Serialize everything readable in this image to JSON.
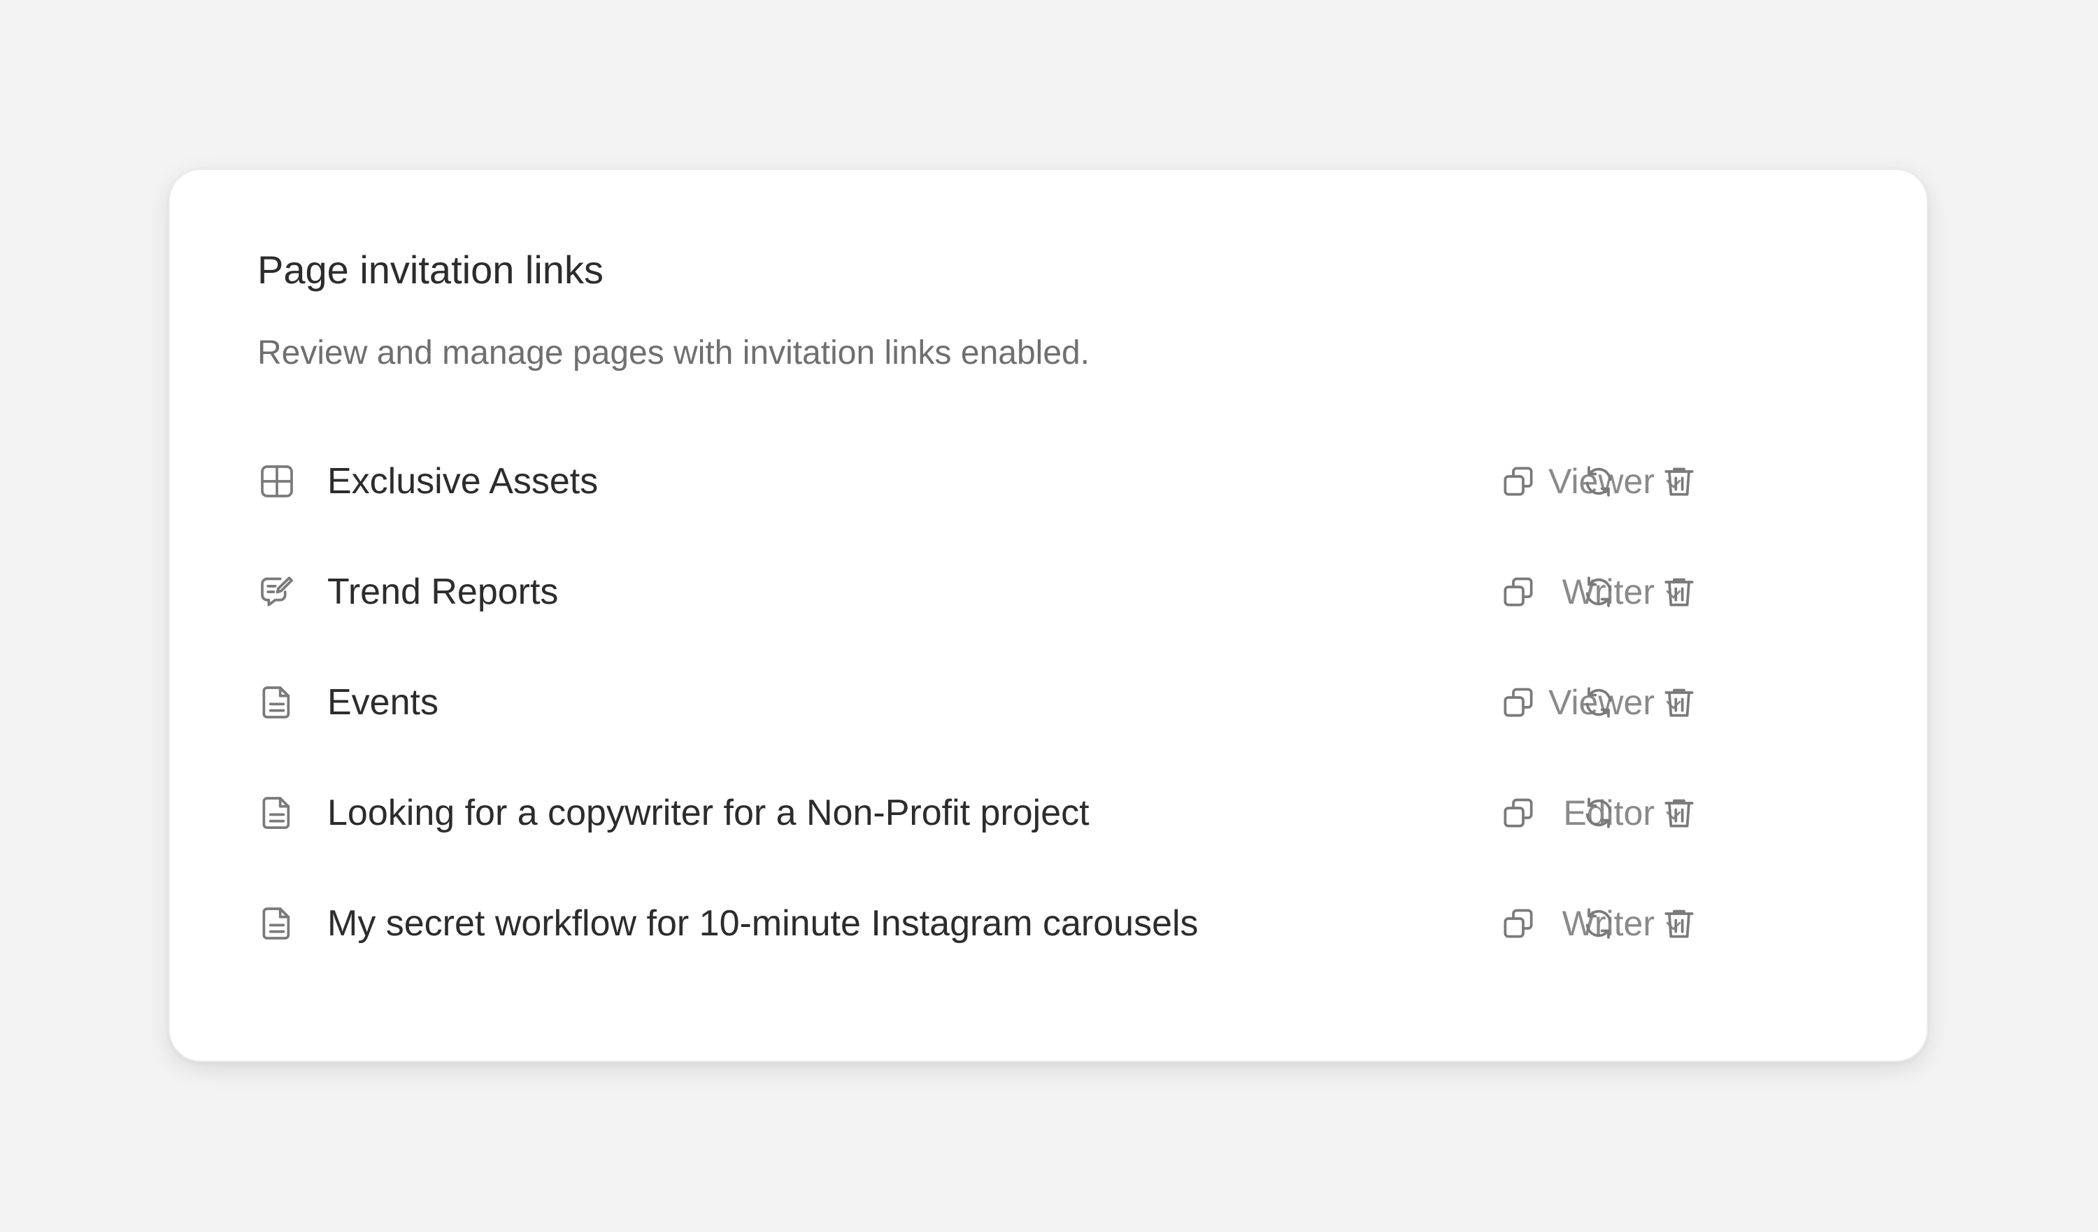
{
  "panel": {
    "title": "Page invitation links",
    "subtitle": "Review and manage pages with invitation links enabled."
  },
  "rows": [
    {
      "icon": "grid-icon",
      "title": "Exclusive Assets",
      "role": "Viewer"
    },
    {
      "icon": "chat-edit-icon",
      "title": "Trend Reports",
      "role": "Writer"
    },
    {
      "icon": "document-icon",
      "title": "Events",
      "role": "Viewer"
    },
    {
      "icon": "document-icon",
      "title": "Looking for a copywriter for a Non-Profit project",
      "role": "Editor"
    },
    {
      "icon": "document-icon",
      "title": "My secret workflow for 10-minute Instagram carousels",
      "role": "Writer"
    }
  ],
  "colors": {
    "background": "#f3f3f3",
    "card": "#ffffff",
    "text": "#2c2c2c",
    "muted": "#6f6f6f",
    "icon": "#7a7a7a"
  }
}
